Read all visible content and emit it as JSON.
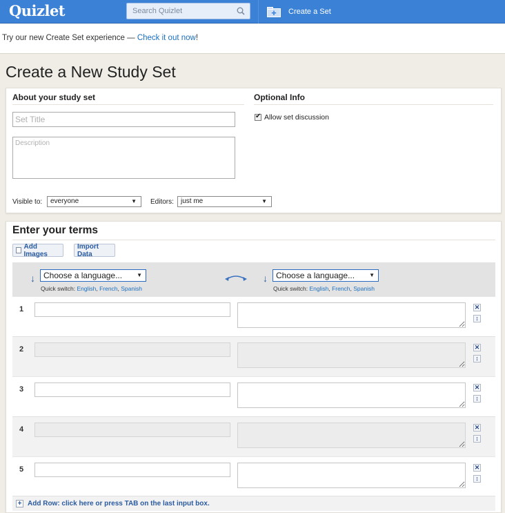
{
  "header": {
    "logo": "Quizlet",
    "search_placeholder": "Search Quizlet",
    "create_label": "Create a Set"
  },
  "banner": {
    "text": "Try our new Create Set experience — ",
    "link": "Check it out now",
    "suffix": "!"
  },
  "page_title": "Create a New Study Set",
  "about": {
    "heading": "About your study set",
    "title_placeholder": "Set Title",
    "description_placeholder": "Description",
    "visible_label": "Visible to:",
    "visible_value": "everyone",
    "editors_label": "Editors:",
    "editors_value": "just me"
  },
  "optional": {
    "heading": "Optional Info",
    "discussion_label": "Allow set discussion",
    "discussion_checked": true
  },
  "terms": {
    "heading": "Enter your terms",
    "add_images": "Add Images",
    "import_data": "Import Data",
    "term_language": "Choose a language...",
    "def_language": "Choose a language...",
    "quick_switch_label": "Quick switch: ",
    "quick_langs": [
      "English",
      "French",
      "Spanish"
    ],
    "rows": [
      "1",
      "2",
      "3",
      "4",
      "5"
    ],
    "add_row": "Add Row: click here or press TAB on the last input box."
  },
  "colors": {
    "brand_blue": "#3b82d6",
    "link": "#1b6fc1",
    "background": "#f0ede6"
  }
}
